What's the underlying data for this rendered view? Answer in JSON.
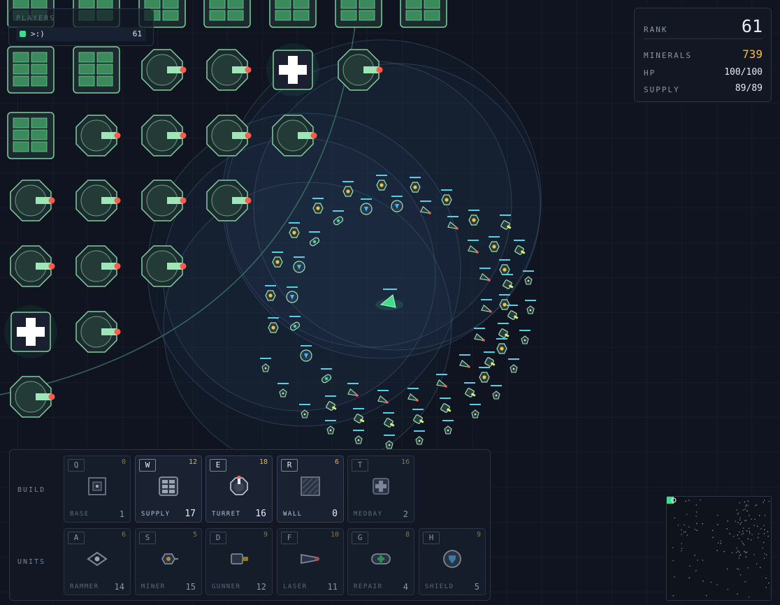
{
  "players": {
    "title": "PLAYERS",
    "list": [
      {
        "name": ">:)",
        "score": "61",
        "color": "#3fdc8a"
      }
    ]
  },
  "stats": {
    "rank_label": "RANK",
    "rank": "61",
    "minerals_label": "MINERALS",
    "minerals": "739",
    "hp_label": "HP",
    "hp": "100/100",
    "supply_label": "SUPPLY",
    "supply": "89/89"
  },
  "build": {
    "label": "BUILD",
    "items": [
      {
        "key": "Q",
        "cost": "0",
        "name": "BASE",
        "count": "1",
        "icon": "base-icon",
        "active": false
      },
      {
        "key": "W",
        "cost": "12",
        "name": "SUPPLY",
        "count": "17",
        "icon": "supply-icon",
        "active": true
      },
      {
        "key": "E",
        "cost": "18",
        "name": "TURRET",
        "count": "16",
        "icon": "turret-icon",
        "active": true
      },
      {
        "key": "R",
        "cost": "6",
        "name": "WALL",
        "count": "0",
        "icon": "wall-icon",
        "active": true
      },
      {
        "key": "T",
        "cost": "16",
        "name": "MEDBAY",
        "count": "2",
        "icon": "medbay-icon",
        "active": false
      }
    ]
  },
  "units": {
    "label": "UNITS",
    "items": [
      {
        "key": "A",
        "cost": "6",
        "name": "RAMMER",
        "count": "14",
        "icon": "rammer-icon",
        "active": false
      },
      {
        "key": "S",
        "cost": "5",
        "name": "MINER",
        "count": "15",
        "icon": "miner-icon",
        "active": false
      },
      {
        "key": "D",
        "cost": "9",
        "name": "GUNNER",
        "count": "12",
        "icon": "gunner-icon",
        "active": false
      },
      {
        "key": "F",
        "cost": "10",
        "name": "LASER",
        "count": "11",
        "icon": "laser-icon",
        "active": false
      },
      {
        "key": "G",
        "cost": "8",
        "name": "REPAIR",
        "count": "4",
        "icon": "repair-icon",
        "active": false
      },
      {
        "key": "H",
        "cost": "9",
        "name": "SHIELD",
        "count": "5",
        "icon": "shield-icon",
        "active": false
      }
    ]
  },
  "colors": {
    "background": "#0f1420",
    "team": "#3fdc8a",
    "building_fill": "#1d2a30",
    "building_stroke": "#7fcf9a",
    "turret_barrel": "#9ee6b8",
    "turret_tip": "#ff5a4a",
    "minerals": "#f0c24a",
    "range_ring": "#4a6a8a"
  }
}
